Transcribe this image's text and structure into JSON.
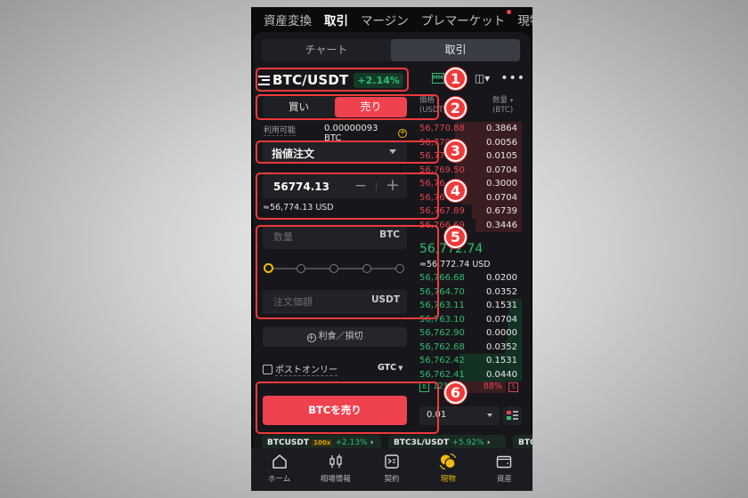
{
  "top_tabs": [
    {
      "label": "資産変換",
      "active": false
    },
    {
      "label": "取引",
      "active": true
    },
    {
      "label": "マージン",
      "active": false
    },
    {
      "label": "プレマーケット",
      "active": false,
      "dot": true
    },
    {
      "label": "現物",
      "active": false
    }
  ],
  "view_tabs": [
    {
      "label": "チャート",
      "active": false
    },
    {
      "label": "取引",
      "active": true
    }
  ],
  "pair": {
    "symbol": "BTC/USDT",
    "change": "+2.14%",
    "icons": [
      "mm-icon",
      "percent-icon",
      "candlestick-icon",
      "more-icon"
    ]
  },
  "side_toggle": {
    "buy": "買い",
    "sell": "売り",
    "selected": "sell"
  },
  "orderbook_headers": {
    "price": "価格",
    "price_unit": "(USDT)",
    "qty": "数量",
    "qty_unit": "(BTC)"
  },
  "available": {
    "label": "利用可能",
    "value": "0.00000093 BTC"
  },
  "order_type": "指値注文",
  "price_input": {
    "value": "56774.13",
    "approx": "≈56,774.13 USD"
  },
  "quantity_input": {
    "placeholder": "数量",
    "unit": "BTC"
  },
  "slider": {
    "value_percent": 0,
    "stops": [
      0,
      25,
      50,
      75,
      100
    ]
  },
  "amount_input": {
    "placeholder": "注文価額",
    "unit": "USDT"
  },
  "tpsl_label": "利食／損切",
  "post_only": {
    "label": "ポストオンリー",
    "checked": false
  },
  "time_in_force": "GTC",
  "submit_label": "BTCを売り",
  "orderbook": {
    "asks": [
      {
        "price": "56,770.88",
        "qty": "0.3864",
        "depth": 0.65
      },
      {
        "price": "56,770.",
        "qty": "0.0056",
        "depth": 0.65
      },
      {
        "price": "56,77",
        "qty": "0.0105",
        "depth": 0.65
      },
      {
        "price": "56,769.50",
        "qty": "0.0704",
        "depth": 0.65
      },
      {
        "price": "56,76",
        "qty": "0.3000",
        "depth": 0.65
      },
      {
        "price": "56,76",
        "qty": "0.0704",
        "depth": 0.58
      },
      {
        "price": "56,767.89",
        "qty": "0.6739",
        "depth": 0.48
      },
      {
        "price": "56,766.69",
        "qty": "0.3446",
        "depth": 0.45
      }
    ],
    "last_price": "56,772.74",
    "last_price_usd": "≈56,772.74 USD",
    "bids": [
      {
        "price": "56,766.68",
        "qty": "0.0200",
        "depth": 0.0
      },
      {
        "price": "56,764.70",
        "qty": "0.0352",
        "depth": 0.0
      },
      {
        "price": "56,763.11",
        "qty": "0.1531",
        "depth": 0.12
      },
      {
        "price": "56,763.10",
        "qty": "0.0704",
        "depth": 0.14
      },
      {
        "price": "56,762.90",
        "qty": "0.0000",
        "depth": 0.14
      },
      {
        "price": "56,762.68",
        "qty": "0.0352",
        "depth": 0.16
      },
      {
        "price": "56,762.42",
        "qty": "0.1531",
        "depth": 0.6
      },
      {
        "price": "56,762.41",
        "qty": "0.0440",
        "depth": 0.6
      }
    ],
    "buy_label": "B",
    "buy_pct": "12%",
    "sell_pct": "88%",
    "sell_label": "S",
    "depth_step": "0.01"
  },
  "tickers": [
    {
      "pair": "BTCUSDT",
      "leverage": "100x",
      "change": "+2.13%"
    },
    {
      "pair": "BTC3L/USDT",
      "change": "+5.92%"
    },
    {
      "pair": "BTC"
    }
  ],
  "bottom_nav": [
    {
      "label": "ホーム",
      "icon": "home-icon",
      "active": false
    },
    {
      "label": "相場情報",
      "icon": "market-icon",
      "active": false
    },
    {
      "label": "契約",
      "icon": "contract-icon",
      "active": false
    },
    {
      "label": "現物",
      "icon": "spot-icon",
      "active": true
    },
    {
      "label": "資産",
      "icon": "wallet-icon",
      "active": false
    }
  ],
  "callouts": [
    "1",
    "2",
    "3",
    "4",
    "5",
    "6"
  ],
  "colors": {
    "accent": "#f0b90b",
    "sell": "#f0424e",
    "buy": "#2ebd6f",
    "annotation": "#f03a3a"
  }
}
